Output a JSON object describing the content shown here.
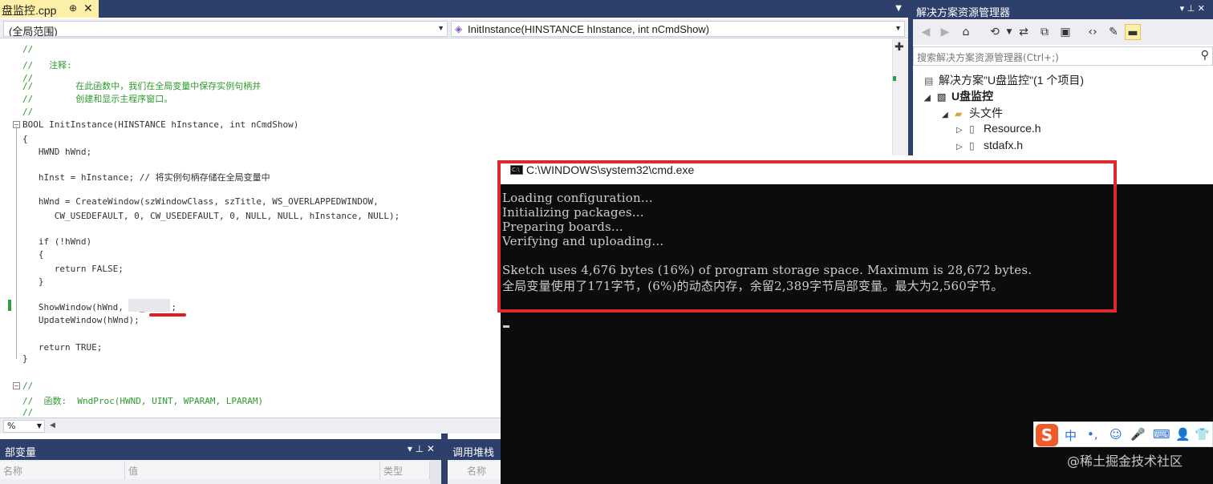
{
  "editor": {
    "tab": {
      "title": "盘监控.cpp",
      "pin": "⊕",
      "close": "✕"
    },
    "scope_combo": "(全局范围)",
    "member_combo": "InitInstance(HINSTANCE hInstance, int nCmdShow)",
    "code": [
      {
        "cls": "cmt",
        "text": "//"
      },
      {
        "cls": "cmt",
        "text": "//   注释:"
      },
      {
        "cls": "cmt",
        "text": "//"
      },
      {
        "cls": "cmt",
        "text": "//        在此函数中，我们在全局变量中保存实例句柄并"
      },
      {
        "cls": "cmt",
        "text": "//        创建和显示主程序窗口。"
      },
      {
        "cls": "cmt",
        "text": "//"
      },
      {
        "cls": "plain",
        "text": "BOOL InitInstance(HINSTANCE hInstance, int nCmdShow)"
      },
      {
        "cls": "plain",
        "text": "{"
      },
      {
        "cls": "plain",
        "text": "   HWND hWnd;"
      },
      {
        "cls": "plain",
        "text": "   hInst = hInstance; // 将实例句柄存储在全局变量中"
      },
      {
        "cls": "plain",
        "text": "   hWnd = CreateWindow(szWindowClass, szTitle, WS_OVERLAPPEDWINDOW,"
      },
      {
        "cls": "plain",
        "text": "      CW_USEDEFAULT, 0, CW_USEDEFAULT, 0, NULL, NULL, hInstance, NULL);"
      },
      {
        "cls": "plain",
        "text": "   if (!hWnd)"
      },
      {
        "cls": "plain",
        "text": "   {"
      },
      {
        "cls": "plain",
        "text": "      return FALSE;"
      },
      {
        "cls": "plain",
        "text": "   }"
      },
      {
        "cls": "plain",
        "text": "   ShowWindow(hWnd, SW_HIDE);"
      },
      {
        "cls": "plain",
        "text": "   UpdateWindow(hWnd);"
      },
      {
        "cls": "plain",
        "text": "   return TRUE;"
      },
      {
        "cls": "plain",
        "text": "}"
      },
      {
        "cls": "cmt",
        "text": "//"
      },
      {
        "cls": "cmt",
        "text": "//  函数:  WndProc(HWND, UINT, WPARAM, LPARAM)"
      },
      {
        "cls": "cmt",
        "text": "//"
      }
    ],
    "zoom": "%"
  },
  "locals_panel": {
    "title": "部变量",
    "controls": "▾ ⊥ ✕",
    "columns": [
      "名称",
      "值",
      "类型"
    ]
  },
  "callstack_panel": {
    "title": "调用堆栈",
    "columns": [
      "名称"
    ]
  },
  "solution_explorer": {
    "title": "解决方案资源管理器",
    "controls": "▾ ⊥ ✕",
    "search_placeholder": "搜索解决方案资源管理器(Ctrl+;)",
    "tree": [
      {
        "label": "解决方案\"U盘监控\"(1 个项目)"
      },
      {
        "label": "U盘监控"
      },
      {
        "label": "头文件"
      },
      {
        "label": "Resource.h"
      },
      {
        "label": "stdafx.h"
      }
    ]
  },
  "cmd": {
    "title": "C:\\WINDOWS\\system32\\cmd.exe",
    "icon_text": "C:\\",
    "lines": [
      "Loading configuration...",
      "Initializing packages...",
      "Preparing boards...",
      "Verifying and uploading...",
      "",
      "Sketch uses 4,676 bytes (16%) of program storage space. Maximum is 28,672 bytes.",
      "全局变量使用了171字节，(6%)的动态内存，余留2,389字节局部变量。最大为2,560字节。"
    ]
  },
  "ime": {
    "logo": "S",
    "mode": "中",
    "punct": "•,",
    "emoji": "☺",
    "mic": "🎤",
    "keyboard": "⌨",
    "user": "👤",
    "shirt": "👕"
  },
  "watermark": "@稀土掘金技术社区",
  "colors": {
    "title_bar": "#2d3f6b",
    "active_tab": "#fff0a8",
    "highlight_box": "#e0282f",
    "console_bg": "#0c0c0c",
    "comment": "#2e9a2e"
  }
}
